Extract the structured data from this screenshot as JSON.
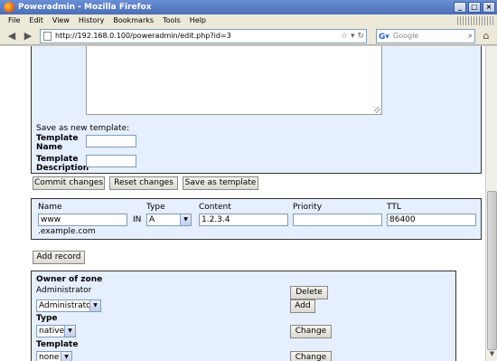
{
  "window": {
    "title": "Poweradmin - Mozilla Firefox"
  },
  "menu": [
    "File",
    "Edit",
    "View",
    "History",
    "Bookmarks",
    "Tools",
    "Help"
  ],
  "nav": {
    "url": "http://192.168.0.100/poweradmin/edit.php?id=3",
    "search_placeholder": "Google"
  },
  "template_form": {
    "save_as_new_label": "Save as new template:",
    "template_name_label": "Template Name",
    "template_description_label": "Template Description",
    "template_name_value": "",
    "template_description_value": ""
  },
  "actions": {
    "commit": "Commit changes",
    "reset": "Reset changes",
    "save_template": "Save as template"
  },
  "record_form": {
    "headers": {
      "name": "Name",
      "type": "Type",
      "content": "Content",
      "priority": "Priority",
      "ttl": "TTL"
    },
    "name_value": "www",
    "in_label": "IN",
    "type_value": "A",
    "content_value": "1.2.3.4",
    "priority_value": "",
    "ttl_value": "86400",
    "domain_suffix": ".example.com"
  },
  "add_record_button": "Add record",
  "zone": {
    "owner_label": "Owner of zone",
    "owner_value": "Administrator",
    "owner_select": "Administrator",
    "delete_button": "Delete",
    "add_button": "Add",
    "type_label": "Type",
    "type_select": "native",
    "change_button": "Change",
    "template_label": "Template",
    "template_select": "none",
    "change_button_2": "Change"
  }
}
